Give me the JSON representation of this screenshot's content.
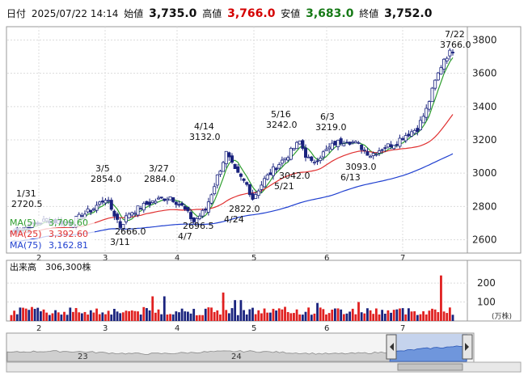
{
  "header": {
    "date_label": "日付",
    "datetime": "2025/07/22 14:14",
    "open_label": "始値",
    "open": "3,735.0",
    "high_label": "高値",
    "high": "3,766.0",
    "low_label": "安値",
    "low": "3,683.0",
    "close_label": "終値",
    "close": "3,752.0"
  },
  "chart_data": [
    {
      "type": "candlestick",
      "y_ticks": [
        "2600",
        "2800",
        "3000",
        "3200",
        "3400",
        "3600",
        "3800"
      ],
      "ylim": [
        2520,
        3880
      ],
      "x_month_labels": [
        "2",
        "3",
        "4",
        "5",
        "6",
        "7"
      ],
      "ma_legend": [
        {
          "label": "MA(5)",
          "value": "3,709.60",
          "color": "#2e9e2e"
        },
        {
          "label": "MA(25)",
          "value": "3,392.60",
          "color": "#e03030"
        },
        {
          "label": "MA(75)",
          "value": "3,162.81",
          "color": "#2040d0"
        }
      ],
      "annotations": [
        {
          "date": "1/31",
          "value": "2720.5",
          "kind": "high"
        },
        {
          "date": "3/5",
          "value": "2854.0",
          "kind": "high"
        },
        {
          "date": "3/11",
          "value": "2666.0",
          "kind": "low"
        },
        {
          "date": "3/27",
          "value": "2884.0",
          "kind": "high"
        },
        {
          "date": "4/7",
          "value": "2696.5",
          "kind": "low"
        },
        {
          "date": "4/14",
          "value": "3132.0",
          "kind": "high"
        },
        {
          "date": "4/24",
          "value": "2822.0",
          "kind": "low"
        },
        {
          "date": "5/16",
          "value": "3242.0",
          "kind": "high"
        },
        {
          "date": "5/21",
          "value": "3042.0",
          "kind": "low"
        },
        {
          "date": "6/3",
          "value": "3219.0",
          "kind": "high"
        },
        {
          "date": "6/13",
          "value": "3093.0",
          "kind": "low"
        },
        {
          "date": "7/22",
          "value": "3766.0",
          "kind": "high"
        }
      ],
      "colors": {
        "up": "#ffffff",
        "down": "#1a237e",
        "ma5": "#2e9e2e",
        "ma25": "#e03030",
        "ma75": "#2040d0"
      }
    },
    {
      "type": "bar",
      "title": "出来高",
      "latest_volume": "306,300株",
      "unit_label": "(万株)",
      "y_ticks": [
        "100",
        "200"
      ],
      "ylim": [
        0,
        260
      ],
      "x_month_labels": [
        "2",
        "3",
        "4",
        "5",
        "6",
        "7"
      ],
      "colors": {
        "up": "#e02020",
        "down": "#1a237e"
      }
    },
    {
      "type": "area",
      "x_labels": [
        "23",
        "24"
      ]
    }
  ]
}
